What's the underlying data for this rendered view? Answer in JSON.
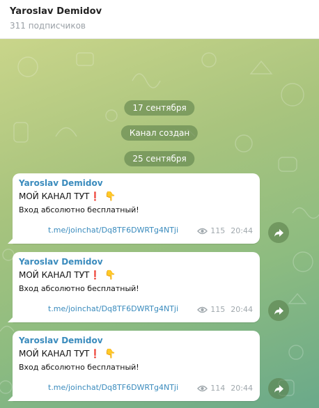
{
  "header": {
    "title": "Yaroslav Demidov",
    "subtitle": "311 подписчиков"
  },
  "service": {
    "date1": "17 сентября",
    "created": "Канал создан",
    "date2": "25 сентября"
  },
  "messages": [
    {
      "author": "Yaroslav Demidov",
      "line1": "МОЙ КАНАЛ ТУТ",
      "mark": "❗",
      "hand": "👇",
      "line2": "Вход абсолютно бесплатный!",
      "link": "t.me/joinchat/Dq8TF6DWRTg4NTji",
      "views": "115",
      "time": "20:44"
    },
    {
      "author": "Yaroslav Demidov",
      "line1": "МОЙ КАНАЛ ТУТ",
      "mark": "❗",
      "hand": "👇",
      "line2": "Вход абсолютно бесплатный!",
      "link": "t.me/joinchat/Dq8TF6DWRTg4NTji",
      "views": "115",
      "time": "20:44"
    },
    {
      "author": "Yaroslav Demidov",
      "line1": "МОЙ КАНАЛ ТУТ",
      "mark": "❗",
      "hand": "👇",
      "line2": "Вход абсолютно бесплатный!",
      "link": "t.me/joinchat/Dq8TF6DWRTg4NTji",
      "views": "114",
      "time": "20:44"
    }
  ],
  "icons": {
    "views": "eye-icon",
    "share": "share-arrow-icon"
  },
  "colors": {
    "accent": "#3a8bbd",
    "service_bg": "#567a46"
  }
}
